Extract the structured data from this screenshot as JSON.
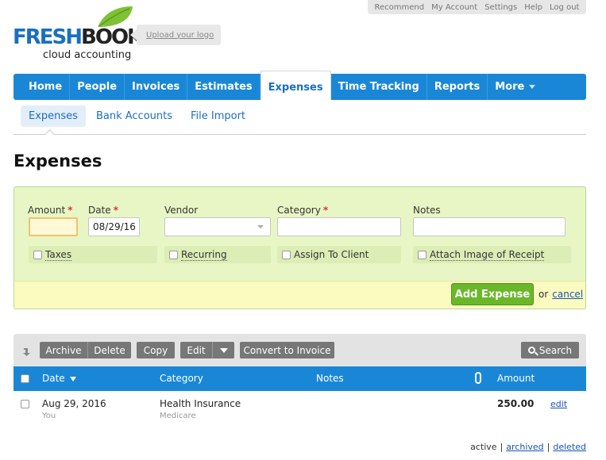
{
  "util_links": [
    "Recommend",
    "My Account",
    "Settings",
    "Help",
    "Log out"
  ],
  "logo": {
    "fresh": "FRESH",
    "books": "BOOKS",
    "tagline": "cloud accounting"
  },
  "upload_logo": "Upload your logo",
  "nav": {
    "tabs": [
      "Home",
      "People",
      "Invoices",
      "Estimates",
      "Expenses",
      "Time Tracking",
      "Reports",
      "More"
    ],
    "active": "Expenses"
  },
  "subnav": {
    "items": [
      "Expenses",
      "Bank Accounts",
      "File Import"
    ],
    "active": "Expenses"
  },
  "page_title": "Expenses",
  "form": {
    "amount_label": "Amount",
    "amount_value": "",
    "date_label": "Date",
    "date_value": "08/29/16",
    "vendor_label": "Vendor",
    "vendor_value": "",
    "category_label": "Category",
    "category_value": "",
    "notes_label": "Notes",
    "notes_value": "",
    "required_mark": "*",
    "checkboxes": [
      "Taxes",
      "Recurring",
      "Assign To Client",
      "Attach Image of Receipt"
    ],
    "add_button": "Add Expense",
    "or_text": "or",
    "cancel_link": "cancel"
  },
  "toolbar": {
    "archive": "Archive",
    "delete": "Delete",
    "copy": "Copy",
    "edit": "Edit",
    "convert": "Convert to Invoice",
    "search": "Search"
  },
  "table": {
    "columns": {
      "date": "Date",
      "category": "Category",
      "notes": "Notes",
      "amount": "Amount"
    },
    "rows": [
      {
        "date": "Aug 29, 2016",
        "date_sub": "You",
        "category": "Health Insurance",
        "category_sub": "Medicare",
        "notes": "",
        "amount": "250.00",
        "edit": "edit"
      }
    ]
  },
  "status_filter": {
    "active": "active",
    "archived": "archived",
    "deleted": "deleted",
    "separator": "|"
  },
  "colors": {
    "nav_blue": "#1a87d6",
    "form_green": "#e8f6c5",
    "add_green": "#6ab82a",
    "leaf_green": "#7ec234"
  }
}
